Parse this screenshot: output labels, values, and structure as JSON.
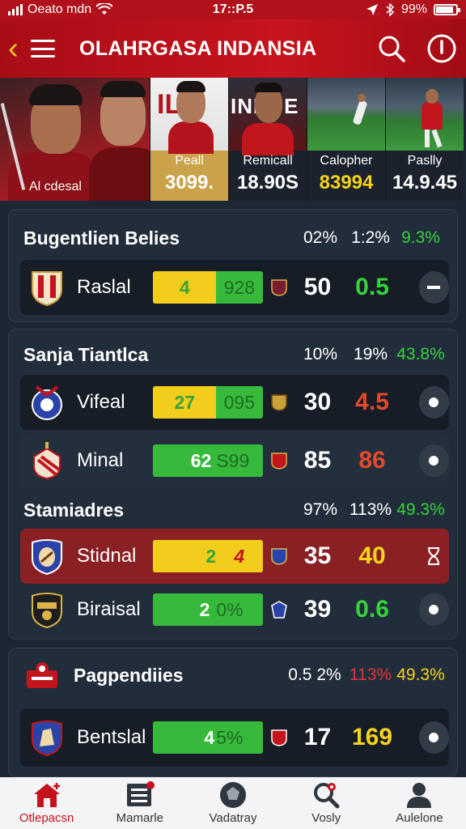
{
  "status_bar": {
    "carrier": "Oeato mdn",
    "time": "17::P.5",
    "battery": "99%",
    "icons": [
      "signal-icon",
      "wifi-icon",
      "location-icon",
      "bluetooth-icon",
      "battery-icon"
    ]
  },
  "app_bar": {
    "title": "OLAHRGASA INDANSIA",
    "icons": [
      "back-chevron-icon",
      "menu-icon",
      "search-icon",
      "power-icon"
    ]
  },
  "hero": {
    "main_caption": "Al cdesal",
    "cards": [
      {
        "label": "Peall",
        "value": "3099.",
        "color": "#ffffff",
        "bg": "#c9a24a"
      },
      {
        "label": "Remicall",
        "value": "18.90S",
        "color": "#ffffff",
        "bg": "#1b222d"
      },
      {
        "label": "Calopher",
        "value": "83994",
        "color": "#f5d31a",
        "bg": "#1b222d"
      },
      {
        "label": "Paslly",
        "value": "14.9.45",
        "value_color_a": "#37d23b",
        "color": "#ffffff",
        "bg": "#1b222d"
      }
    ]
  },
  "sections": [
    {
      "title": "Bugentlien Belies",
      "cols": [
        {
          "text": "02%",
          "color": "#ffffff"
        },
        {
          "text": "1:2%",
          "color": "#ffffff"
        },
        {
          "text": "9.3%",
          "color": "#37d23b"
        }
      ],
      "rows": [
        {
          "team": "Raslal",
          "bar_a": "4",
          "bar_b": "928",
          "bar_a_color": "#f3cd1c",
          "bar_b_color": "#37b93c",
          "n1": "50",
          "n2": "0.5",
          "n2_color": "#37d23b",
          "action": "minus",
          "highlight": false
        }
      ]
    },
    {
      "title": "Sanja Tiantlca",
      "cols": [
        {
          "text": "10%",
          "color": "#ffffff"
        },
        {
          "text": "19%",
          "color": "#ffffff"
        },
        {
          "text": "43.8%",
          "color": "#37d23b"
        }
      ],
      "rows": [
        {
          "team": "Vifeal",
          "bar_a": "27",
          "bar_b": "095",
          "bar_a_color": "#f3cd1c",
          "bar_b_color": "#37b93c",
          "n1": "30",
          "n2": "4.5",
          "n2_color": "#e34a2c",
          "action": "dot",
          "highlight": false
        },
        {
          "team": "Minal",
          "bar_a": "62",
          "bar_b": "S99",
          "bar_a_color": "#37b93c",
          "bar_b_color": "#37b93c",
          "n1": "85",
          "n2": "86",
          "n2_color": "#e34a2c",
          "action": "dot",
          "highlight": false
        }
      ]
    },
    {
      "title": "Stamiadres",
      "cols": [
        {
          "text": "97%",
          "color": "#ffffff"
        },
        {
          "text": "113%",
          "color": "#ffffff"
        },
        {
          "text": "49.3%",
          "color": "#37d23b"
        }
      ],
      "rows": [
        {
          "team": "Stidnal",
          "bar_a": "2",
          "bar_b": "4",
          "bar_a_color": "#f3cd1c",
          "bar_b_color": "#f3cd1c",
          "n1": "35",
          "n2": "40",
          "n2_color": "#f5d31a",
          "action": "hourglass",
          "highlight": true
        },
        {
          "team": "Biraisal",
          "bar_a": "2",
          "bar_b": "0%",
          "bar_a_color": "#37b93c",
          "bar_b_color": "#37b93c",
          "n1": "39",
          "n2": "0.6",
          "n2_color": "#37d23b",
          "action": "dot",
          "highlight": false
        }
      ]
    },
    {
      "title": "Pagpendiies",
      "cols": [
        {
          "text": "0.5 2%",
          "color": "#ffffff"
        },
        {
          "text": "113%",
          "color": "#e0343a"
        },
        {
          "text": "49.3%",
          "color": "#f5d31a"
        }
      ],
      "rows": [
        {
          "team": "Bentslal",
          "bar_a": "4",
          "bar_b": "5%",
          "bar_a_color": "#37b93c",
          "bar_b_color": "#37b93c",
          "n1": "17",
          "n2": "169",
          "n2_color": "#f5d31a",
          "action": "dot",
          "highlight": false
        }
      ]
    }
  ],
  "bottom_nav": [
    {
      "label": "Otlepacsn",
      "icon": "home-icon",
      "active": true
    },
    {
      "label": "Mamarle",
      "icon": "list-icon",
      "active": false
    },
    {
      "label": "Vadatray",
      "icon": "ball-icon",
      "active": false
    },
    {
      "label": "Vosly",
      "icon": "search-icon",
      "active": false
    },
    {
      "label": "Aulelone",
      "icon": "profile-icon",
      "active": false
    }
  ],
  "colors": {
    "brand_red": "#c4121b",
    "accent_yellow": "#f3cd1c",
    "accent_green": "#37b93c",
    "background": "#1d2633"
  }
}
